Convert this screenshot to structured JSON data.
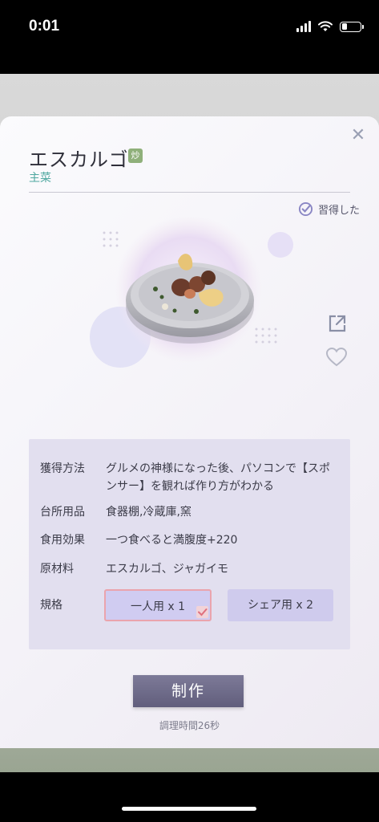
{
  "status_bar": {
    "time": "0:01"
  },
  "dialog": {
    "title": "エスカルゴ",
    "cook_method_tag": "炒",
    "category": "主菜",
    "learned_label": "習得した"
  },
  "info": {
    "rows": [
      {
        "label": "獲得方法",
        "value": "グルメの神様になった後、パソコンで【スポンサー】を観れば作り方がわかる"
      },
      {
        "label": "台所用品",
        "value": "食器棚,冷蔵庫,窯"
      },
      {
        "label": "食用効果",
        "value": "一つ食べると満腹度+220"
      },
      {
        "label": "原材料",
        "value": "エスカルゴ、ジャガイモ"
      }
    ],
    "spec_label": "規格",
    "spec_options": [
      "一人用 x 1",
      "シェア用 x 2"
    ],
    "spec_selected": "一人用 x 1"
  },
  "craft_label": "制作",
  "cook_time": "調理時間26秒",
  "colors": {
    "accent_teal": "#4fa8a0",
    "panel": "#e2dfef",
    "craft_button": "#6e6b8a",
    "selected_border": "#eaa4ad"
  },
  "icons": [
    "close-icon",
    "check-circle-icon",
    "share-icon",
    "heart-icon",
    "checkmark-icon"
  ]
}
